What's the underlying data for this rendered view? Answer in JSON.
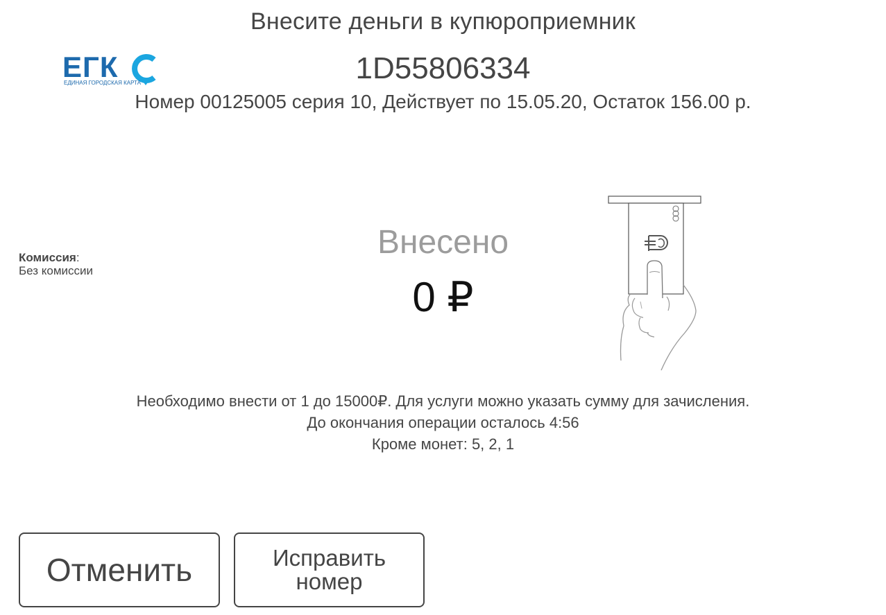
{
  "header": {
    "title": "Внесите деньги в купюроприемник",
    "card_id": "1D55806334",
    "card_info": "Номер 00125005 серия 10, Действует по 15.05.20, Остаток 156.00 р."
  },
  "logo": {
    "letters": "ЕГК",
    "subtitle": "ЕДИНАЯ ГОРОДСКАЯ КАРТА",
    "brand_color": "#1d6aad",
    "accent_color": "#1ba6e0"
  },
  "commission": {
    "label": "Комиссия",
    "colon": ":",
    "value": "Без комиссии"
  },
  "deposit": {
    "label": "Внесено",
    "amount": "0 ₽"
  },
  "info": {
    "line1": "Необходимо внести от 1 до 15000₽. Для услуги можно указать сумму для зачисления.",
    "line2": "До окончания операции осталось 4:56",
    "line3": "Кроме монет:  5, 2, 1"
  },
  "buttons": {
    "cancel": "Отменить",
    "fix_number": "Исправить номер"
  },
  "illustration": {
    "icon": "hand-inserting-banknote-icon"
  }
}
